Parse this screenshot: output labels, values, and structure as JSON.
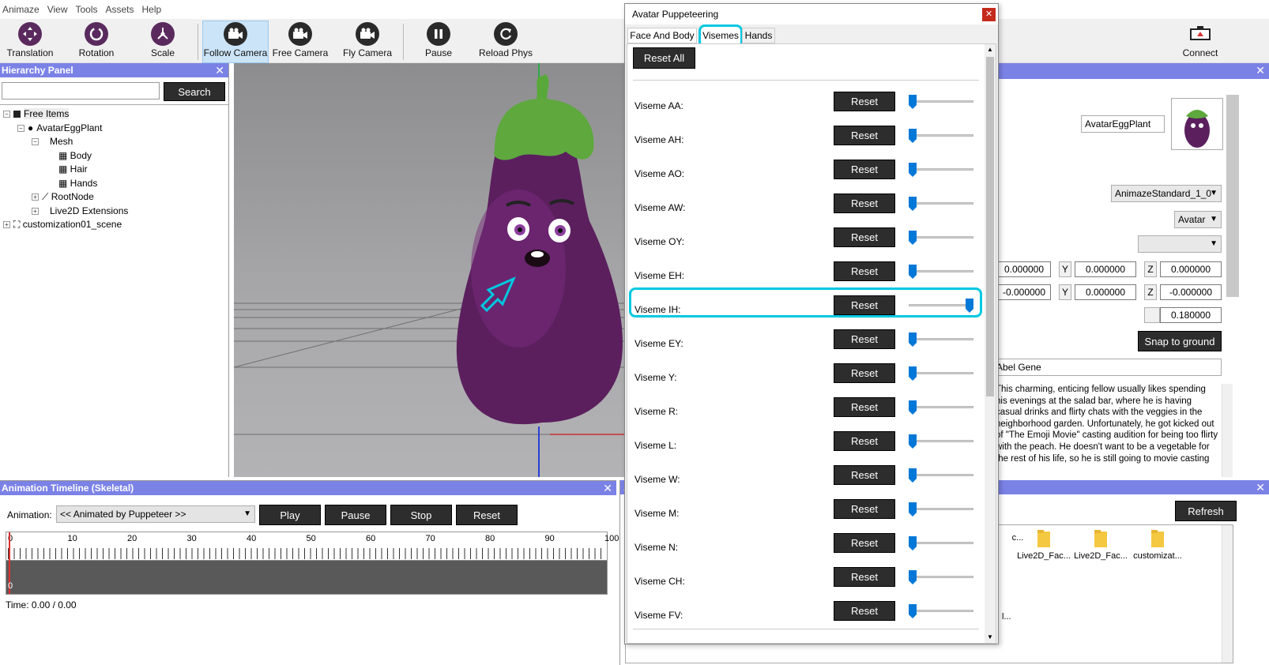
{
  "menu": [
    "Animaze",
    "View",
    "Tools",
    "Assets",
    "Help"
  ],
  "toolbar": {
    "translation": "Translation",
    "rotation": "Rotation",
    "scale": "Scale",
    "follow_camera": "Follow Camera",
    "free_camera": "Free Camera",
    "fly_camera": "Fly Camera",
    "pause": "Pause",
    "reload_phys": "Reload Phys",
    "connect": "Connect"
  },
  "hierarchy": {
    "title": "Hierarchy Panel",
    "search_label": "Search",
    "search_value": "",
    "items": {
      "free_items": "Free Items",
      "avatar": "AvatarEggPlant",
      "mesh": "Mesh",
      "body": "Body",
      "hair": "Hair",
      "hands": "Hands",
      "rootnode": "RootNode",
      "live2d": "Live2D Extensions",
      "scene": "customization01_scene"
    }
  },
  "timeline": {
    "title": "Animation Timeline (Skeletal)",
    "animation_label": "Animation:",
    "animation_value": "<< Animated by Puppeteer >>",
    "play": "Play",
    "pause": "Pause",
    "stop": "Stop",
    "reset": "Reset",
    "ticks": [
      "0",
      "10",
      "20",
      "30",
      "40",
      "50",
      "60",
      "70",
      "80",
      "90",
      "100"
    ],
    "row_zero": "0",
    "time": "Time: 0.00 / 0.00"
  },
  "dialog": {
    "title": "Avatar Puppeteering",
    "tabs": [
      "Face And Body",
      "Visemes",
      "Hands"
    ],
    "reset_all": "Reset All",
    "reset_label": "Reset",
    "visemes": [
      {
        "label": "Viseme AA:",
        "value": 0.0
      },
      {
        "label": "Viseme AH:",
        "value": 0.0
      },
      {
        "label": "Viseme AO:",
        "value": 0.0
      },
      {
        "label": "Viseme AW:",
        "value": 0.0
      },
      {
        "label": "Viseme OY:",
        "value": 0.0
      },
      {
        "label": "Viseme EH:",
        "value": 0.0
      },
      {
        "label": "Viseme IH:",
        "value": 1.0
      },
      {
        "label": "Viseme EY:",
        "value": 0.0
      },
      {
        "label": "Viseme Y:",
        "value": 0.0
      },
      {
        "label": "Viseme R:",
        "value": 0.0
      },
      {
        "label": "Viseme L:",
        "value": 0.0
      },
      {
        "label": "Viseme W:",
        "value": 0.0
      },
      {
        "label": "Viseme M:",
        "value": 0.0
      },
      {
        "label": "Viseme N:",
        "value": 0.0
      },
      {
        "label": "Viseme CH:",
        "value": 0.0
      },
      {
        "label": "Viseme FV:",
        "value": 0.0
      }
    ]
  },
  "properties": {
    "name": "AvatarEggPlant",
    "standard": "AnimazeStandard_1_0",
    "type": "Avatar",
    "blank_combo": "",
    "pos": {
      "x": "0.000000",
      "y_label": "Y",
      "y": "0.000000",
      "z_label": "Z",
      "z": "0.000000"
    },
    "rot": {
      "x": "-0.000000",
      "y_label": "Y",
      "y": "0.000000",
      "z_label": "Z",
      "z": "-0.000000"
    },
    "scale": "0.180000",
    "snap": "Snap to ground",
    "display_name": "Abel Gene",
    "description": "This charming, enticing fellow usually likes spending his evenings at the salad bar, where he is having casual drinks and flirty chats with the veggies in the neighborhood garden. Unfortunately, he got kicked out of \"The Emoji Movie\" casting audition for being too flirty with the peach. He doesn't want to be a vegetable for the rest of his life, so he is still going to movie casting"
  },
  "assets": {
    "refresh": "Refresh",
    "folders": [
      "c...",
      "Live2D_Fac...",
      "Live2D_Fac...",
      "customizat..."
    ],
    "tail": "l..."
  },
  "colors": {
    "accent": "#7b82e6",
    "highlight": "#00c8e0",
    "thumb": "#0078d7"
  }
}
